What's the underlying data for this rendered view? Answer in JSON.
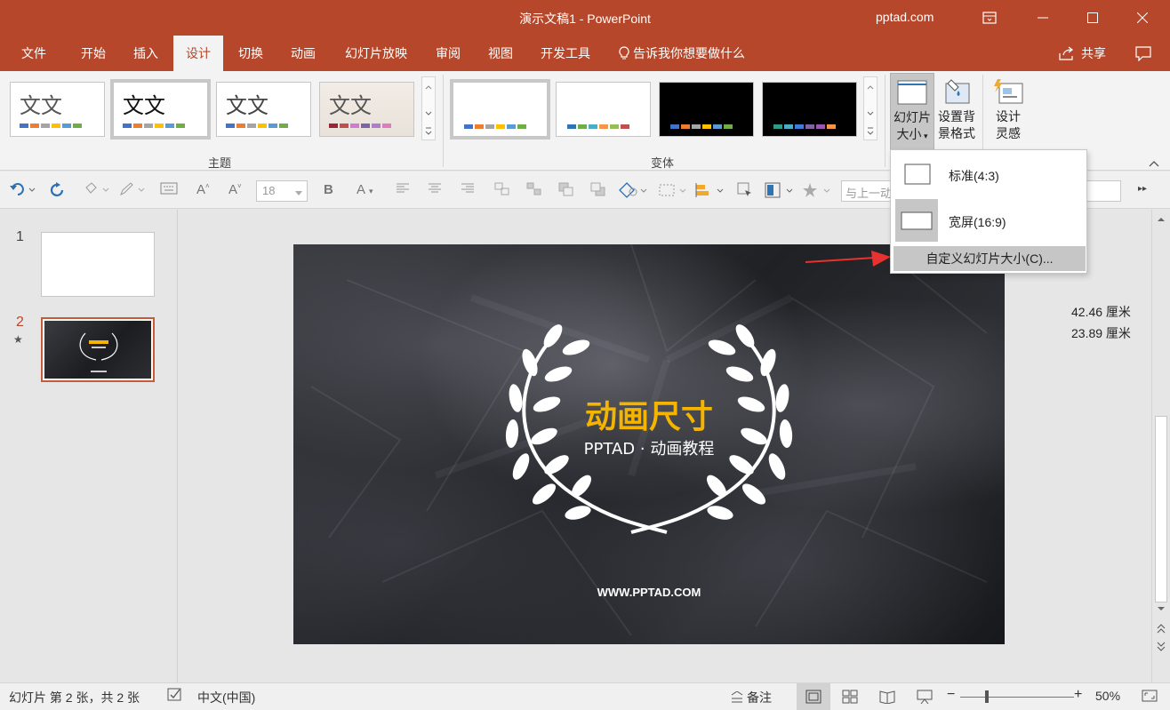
{
  "window": {
    "title": "演示文稿1 - PowerPoint",
    "user": "pptad.com"
  },
  "tabs": [
    {
      "label": "文件"
    },
    {
      "label": "开始"
    },
    {
      "label": "插入"
    },
    {
      "label": "设计"
    },
    {
      "label": "切换"
    },
    {
      "label": "动画"
    },
    {
      "label": "幻灯片放映"
    },
    {
      "label": "审阅"
    },
    {
      "label": "视图"
    },
    {
      "label": "开发工具"
    }
  ],
  "tell_me": "告诉我你想要做什么",
  "share": "共享",
  "ribbon": {
    "themes_label": "主题",
    "variants_label": "变体",
    "theme_sample_text": "文文",
    "slide_size_line1": "幻灯片",
    "slide_size_line2": "大小",
    "format_bg_line1": "设置背",
    "format_bg_line2": "景格式",
    "designer_line1": "设计",
    "designer_line2": "灵感"
  },
  "toolbar": {
    "font_size": "18",
    "align_placeholder": "与上一动"
  },
  "slides_panel": {
    "slides": [
      {
        "number": "1"
      },
      {
        "number": "2"
      }
    ]
  },
  "slide": {
    "title": "动画尺寸",
    "subtitle": "PPTAD · 动画教程",
    "url": "WWW.PPTAD.COM"
  },
  "dimensions": {
    "width": "42.46 厘米",
    "height": "23.89 厘米"
  },
  "slide_size_menu": {
    "standard": "标准(4:3)",
    "widescreen": "宽屏(16:9)",
    "custom": "自定义幻灯片大小(C)..."
  },
  "status": {
    "slide_info": "幻灯片 第 2 张，共 2 张",
    "language": "中文(中国)",
    "notes": "备注",
    "zoom": "50%"
  },
  "colors": {
    "accent": "#b7472a",
    "slide_title": "#f5b400",
    "annotation_arrow": "#e8322f"
  }
}
